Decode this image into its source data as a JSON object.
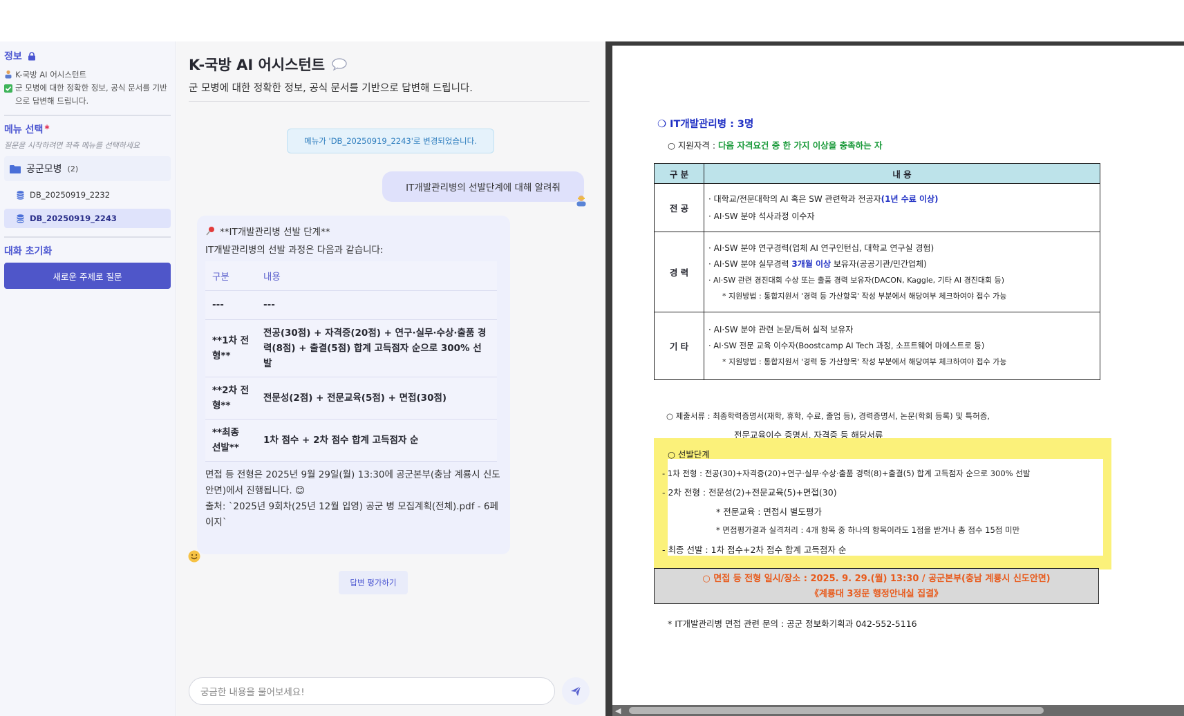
{
  "sidebar": {
    "info_title": "정보",
    "info_line1": "K-국방 AI 어시스턴트",
    "info_line2": "군 모병에 대한 정확한 정보, 공식 문서를 기반으로 답변해 드립니다.",
    "menu_title": "메뉴 선택",
    "required_mark": "*",
    "menu_hint": "질문을 시작하려면 좌측 메뉴를 선택하세요",
    "folder_label": "공군모병",
    "folder_count": "(2)",
    "db_items": [
      {
        "label": "DB_20250919_2232",
        "active": false
      },
      {
        "label": "DB_20250919_2243",
        "active": true
      }
    ],
    "reset_title": "대화 초기화",
    "new_topic_button": "새로운 주제로 질문"
  },
  "main": {
    "title": "K-국방 AI 어시스턴트",
    "subtitle": "군 모병에 대한 정확한 정보, 공식 문서를 기반으로 답변해 드립니다.",
    "system_message": "메뉴가 'DB_20250919_2243'로 변경되었습니다.",
    "user_message": "IT개발관리병의 선발단계에 대해 알려줘",
    "bot": {
      "heading": "**IT개발관리병 선발 단계**",
      "intro": "IT개발관리병의 선발 과정은 다음과 같습니다:",
      "table_headers": [
        "구분",
        "내용"
      ],
      "rows": [
        {
          "c1": "---",
          "c2": "---"
        },
        {
          "c1": "**1차 전형**",
          "c2": "전공(30점) + 자격증(20점) + 연구·실무·수상·출품 경력(8점) + 출결(5점) 합계 고득점자 순으로 300% 선발"
        },
        {
          "c1": "**2차 전형**",
          "c2": "전문성(2점) + 전문교육(5점) + 면접(30점)"
        },
        {
          "c1": "**최종 선발**",
          "c2": "1차 점수 + 2차 점수 합계 고득점자 순"
        }
      ],
      "footer1": "면접 등 전형은 2025년 9월 29일(월) 13:30에 공군본부(충남 계룡시 신도안면)에서 진행됩니다. 😊",
      "footer2": "출처: `2025년 9회차(25년 12월 입영) 공군 병 모집계획(전체).pdf - 6페이지`"
    },
    "rate_button": "답변 평가하기",
    "input_placeholder": "궁금한 내용을 물어보세요!"
  },
  "pdf": {
    "heading": "❍ IT개발관리병 : 3명",
    "qual_prefix": "○ 지원자격 : ",
    "qual_green": "다음 자격요건 중 한 가지 이상을 충족하는 자",
    "table_headers": [
      "구 분",
      "내    용"
    ],
    "major_cat": "전 공",
    "major_line1_a": "· 대학교/전문대학의 AI 혹은 SW 관련학과 전공자",
    "major_line1_b": "(1년 수료 이상)",
    "major_line2": "· AI·SW 분야 석사과정 이수자",
    "career_cat": "경 력",
    "career_line1": "· AI·SW 분야 연구경력(업체 AI 연구인턴십, 대학교 연구실 경험)",
    "career_line2_a": "· AI·SW 분야 실무경력 ",
    "career_line2_b": "3개월 이상",
    "career_line2_c": " 보유자(공공기관/민간업체)",
    "career_line3": "· AI·SW 관련 경진대회 수상 또는 출품 경력 보유자(DACON, Kaggle, 기타 AI 경진대회 등)",
    "career_note": "* 지원방법 : 통합지원서 '경력 등 가산항목' 작성 부분에서 해당여부 체크하여야 접수 가능",
    "etc_cat": "기 타",
    "etc_line1": "· AI·SW 분야 관련 논문/특허 실적 보유자",
    "etc_line2": "· AI·SW 전문 교육 이수자(Boostcamp AI Tech 과정, 소프트웨어 마에스트로 등)",
    "etc_note": "* 지원방법 : 통합지원서 '경력 등 가산항목' 작성 부분에서 해당여부 체크하여야 접수 가능",
    "docs_line1": "○  제출서류 : 최종학력증명서(재학, 휴학, 수료, 졸업 등), 경력증명서, 논문(학회 등록) 및 특허증,",
    "docs_line2": "전문교육이수 증명서,  자격증 등 해당서류",
    "steps_title": "○ 선발단계",
    "step1": "- 1차 전형 : 전공(30)+자격증(20)+연구·실무·수상·출품 경력(8)+출결(5) 합계 고득점자 순으로 300% 선발",
    "step2": "- 2차 전형 : 전문성(2)+전문교육(5)+면접(30)",
    "step2_note1": "* 전문교육 : 면접시 별도평가",
    "step2_note2": "* 면접평가결과 실격처리 : 4개 항목 중 하나의 항목이라도 1점을 받거나 총 점수 15점 미만",
    "step3": "- 최종 선발 : 1차 점수+2차 점수 합계 고득점자 순",
    "interview_line1": "○ 면접 등 전형 일시/장소 : 2025. 9. 29.(월) 13:30 / 공군본부(충남 계룡시 신도안면)",
    "interview_line2": "《계룡대 3정문 행정안내실 집결》",
    "contact": "* IT개발관리병 면접 관련 문의 : 공군 정보화기획과 042-552-5116"
  },
  "colors": {
    "accent": "#4a55d1",
    "button": "#4f56c9",
    "highlight": "#fbf17a",
    "pdf_blue": "#1f2fc4",
    "pdf_green": "#1a9a3a",
    "pdf_orange": "#e85a1b"
  },
  "icons": [
    "lock-icon",
    "person-icon",
    "check-icon",
    "folder-icon",
    "database-icon",
    "speech-bubble-icon",
    "pin-icon",
    "smile-icon",
    "send-icon"
  ]
}
